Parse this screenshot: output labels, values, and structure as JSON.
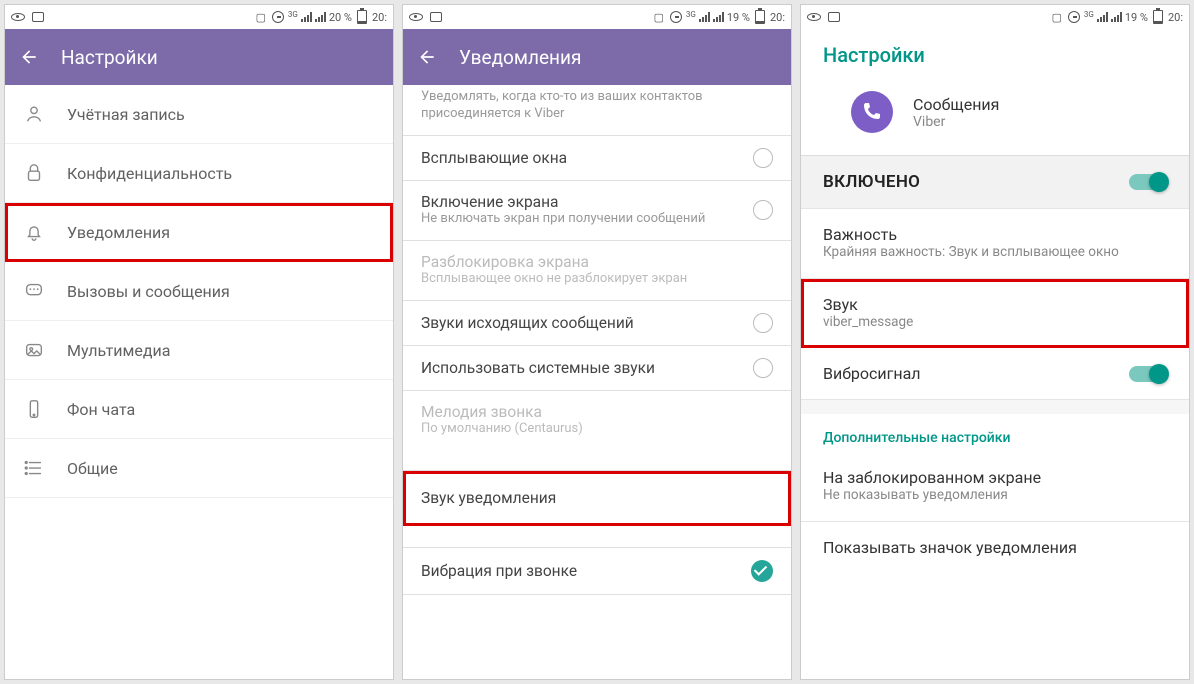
{
  "statusbar": {
    "s1": {
      "battery": "20 %",
      "time": "20:"
    },
    "s2": {
      "battery": "19 %",
      "time": "20:"
    },
    "s3": {
      "battery": "19 %",
      "time": "20:"
    },
    "net3g": "3G"
  },
  "screen1": {
    "title": "Настройки",
    "items": {
      "account": "Учётная запись",
      "privacy": "Конфиденциальность",
      "notifications": "Уведомления",
      "calls": "Вызовы и сообщения",
      "media": "Мультимедиа",
      "chatbg": "Фон чата",
      "general": "Общие"
    }
  },
  "screen2": {
    "title": "Уведомления",
    "join_sub": "Уведомлять, когда кто-то из ваших контактов присоединяется к Viber",
    "popup": "Всплывающие окна",
    "screen_on": "Включение экрана",
    "screen_on_sub": "Не включать экран при получении сообщений",
    "unlock": "Разблокировка экрана",
    "unlock_sub": "Всплывающее окно не разблокирует экран",
    "out_sounds": "Звуки исходящих сообщений",
    "sys_sounds": "Использовать системные звуки",
    "ringtone": "Мелодия звонка",
    "ringtone_sub": "По умолчанию (Centaurus)",
    "notif_sound": "Звук уведомления",
    "vibrate_call": "Вибрация при звонке"
  },
  "screen3": {
    "title": "Настройки",
    "app_name": "Сообщения",
    "app_sub": "Viber",
    "enabled": "ВКЛЮЧЕНО",
    "importance": "Важность",
    "importance_sub": "Крайняя важность: Звук и всплывающее окно",
    "sound": "Звук",
    "sound_sub": "viber_message",
    "vibro": "Вибросигнал",
    "extra": "Дополнительные настройки",
    "lockscreen": "На заблокированном экране",
    "lockscreen_sub": "Не показывать уведомления",
    "badge": "Показывать значок уведомления"
  }
}
